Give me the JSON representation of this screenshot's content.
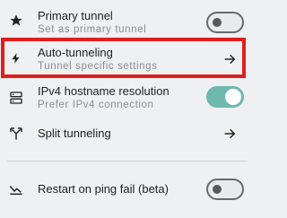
{
  "items": [
    {
      "title": "Primary tunnel",
      "subtitle": "Set as primary tunnel",
      "icon": "star-icon",
      "control": "toggle",
      "state": "off"
    },
    {
      "title": "Auto-tunneling",
      "subtitle": "Tunnel specific settings",
      "icon": "bolt-icon",
      "control": "arrow"
    },
    {
      "title": "IPv4 hostname resolution",
      "subtitle": "Prefer IPv4 connection",
      "icon": "server-icon",
      "control": "toggle",
      "state": "on"
    },
    {
      "title": "Split tunneling",
      "subtitle": "",
      "icon": "split-icon",
      "control": "arrow"
    },
    {
      "title": "Restart on ping fail (beta)",
      "subtitle": "",
      "icon": "ping-icon",
      "control": "toggle",
      "state": "off"
    }
  ],
  "colors": {
    "accent": "#6fb8ae",
    "highlight": "#e01e1e"
  }
}
